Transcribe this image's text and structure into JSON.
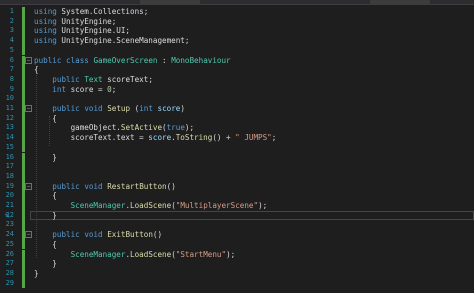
{
  "editor": {
    "lines": [
      {
        "n": "1",
        "tokens": [
          [
            "kw",
            "using"
          ],
          [
            "pl",
            " System.Collections;"
          ]
        ]
      },
      {
        "n": "2",
        "tokens": [
          [
            "kw",
            "using"
          ],
          [
            "pl",
            " UnityEngine;"
          ]
        ]
      },
      {
        "n": "3",
        "tokens": [
          [
            "kw",
            "using"
          ],
          [
            "pl",
            " UnityEngine.UI;"
          ]
        ]
      },
      {
        "n": "4",
        "tokens": [
          [
            "kw",
            "using"
          ],
          [
            "pl",
            " UnityEngine.SceneManagement;"
          ]
        ]
      },
      {
        "n": "5",
        "tokens": []
      },
      {
        "n": "6",
        "tokens": [
          [
            "kw",
            "public"
          ],
          [
            "pl",
            " "
          ],
          [
            "kw",
            "class"
          ],
          [
            "pl",
            " "
          ],
          [
            "ty",
            "GameOverScreen"
          ],
          [
            "pl",
            " : "
          ],
          [
            "ty",
            "MonoBehaviour"
          ]
        ]
      },
      {
        "n": "7",
        "tokens": [
          [
            "pl",
            "{"
          ]
        ]
      },
      {
        "n": "8",
        "tokens": [
          [
            "pl",
            "    "
          ],
          [
            "kw",
            "public"
          ],
          [
            "pl",
            " "
          ],
          [
            "ty",
            "Text"
          ],
          [
            "pl",
            " scoreText;"
          ]
        ]
      },
      {
        "n": "9",
        "tokens": [
          [
            "pl",
            "    "
          ],
          [
            "kw",
            "int"
          ],
          [
            "pl",
            " score = "
          ],
          [
            "nm",
            "0"
          ],
          [
            "pl",
            ";"
          ]
        ]
      },
      {
        "n": "10",
        "tokens": []
      },
      {
        "n": "11",
        "tokens": [
          [
            "pl",
            "    "
          ],
          [
            "kw",
            "public"
          ],
          [
            "pl",
            " "
          ],
          [
            "kw",
            "void"
          ],
          [
            "pl",
            " "
          ],
          [
            "mt",
            "Setup"
          ],
          [
            "pl",
            " ("
          ],
          [
            "kw",
            "int"
          ],
          [
            "pl",
            " "
          ],
          [
            "id",
            "score"
          ],
          [
            "pl",
            ")"
          ]
        ]
      },
      {
        "n": "12",
        "tokens": [
          [
            "pl",
            "    {"
          ]
        ]
      },
      {
        "n": "13",
        "tokens": [
          [
            "pl",
            "        gameObject."
          ],
          [
            "mt",
            "SetActive"
          ],
          [
            "pl",
            "("
          ],
          [
            "kw",
            "true"
          ],
          [
            "pl",
            ");"
          ]
        ]
      },
      {
        "n": "14",
        "tokens": [
          [
            "pl",
            "        scoreText.text = "
          ],
          [
            "id",
            "score"
          ],
          [
            "pl",
            "."
          ],
          [
            "mt",
            "ToString"
          ],
          [
            "pl",
            "() + "
          ],
          [
            "str",
            "\" JUMPS\""
          ],
          [
            "pl",
            ";"
          ]
        ]
      },
      {
        "n": "15",
        "tokens": []
      },
      {
        "n": "16",
        "tokens": [
          [
            "pl",
            "    }"
          ]
        ]
      },
      {
        "n": "17",
        "tokens": []
      },
      {
        "n": "18",
        "tokens": []
      },
      {
        "n": "19",
        "tokens": [
          [
            "pl",
            "    "
          ],
          [
            "kw",
            "public"
          ],
          [
            "pl",
            " "
          ],
          [
            "kw",
            "void"
          ],
          [
            "pl",
            " "
          ],
          [
            "mt",
            "RestartButton"
          ],
          [
            "pl",
            "()"
          ]
        ]
      },
      {
        "n": "20",
        "tokens": [
          [
            "pl",
            "    {"
          ]
        ]
      },
      {
        "n": "21",
        "tokens": [
          [
            "pl",
            "        "
          ],
          [
            "ty",
            "SceneManager"
          ],
          [
            "pl",
            "."
          ],
          [
            "mt",
            "LoadScene"
          ],
          [
            "pl",
            "("
          ],
          [
            "str",
            "\"MultiplayerScene\""
          ],
          [
            "pl",
            ");"
          ]
        ]
      },
      {
        "n": "22",
        "tokens": [
          [
            "pl",
            "    }"
          ]
        ]
      },
      {
        "n": "23",
        "tokens": []
      },
      {
        "n": "24",
        "tokens": [
          [
            "pl",
            "    "
          ],
          [
            "kw",
            "public"
          ],
          [
            "pl",
            " "
          ],
          [
            "kw",
            "void"
          ],
          [
            "pl",
            " "
          ],
          [
            "mt",
            "ExitButton"
          ],
          [
            "pl",
            "()"
          ]
        ]
      },
      {
        "n": "25",
        "tokens": [
          [
            "pl",
            "    {"
          ]
        ]
      },
      {
        "n": "26",
        "tokens": [
          [
            "pl",
            "        "
          ],
          [
            "ty",
            "SceneManager"
          ],
          [
            "pl",
            "."
          ],
          [
            "mt",
            "LoadScene"
          ],
          [
            "pl",
            "("
          ],
          [
            "str",
            "\"StartMenu\""
          ],
          [
            "pl",
            ");"
          ]
        ]
      },
      {
        "n": "27",
        "tokens": [
          [
            "pl",
            "    }"
          ]
        ]
      },
      {
        "n": "28",
        "tokens": [
          [
            "pl",
            "}"
          ]
        ]
      },
      {
        "n": "29",
        "tokens": []
      }
    ],
    "folds": {
      "6": "−",
      "11": "−",
      "19": "−",
      "24": "−"
    },
    "changed_lines": [
      "1",
      "2",
      "3",
      "4",
      "5",
      "6",
      "7",
      "8",
      "9",
      "10",
      "11",
      "12",
      "13",
      "14",
      "15",
      "16",
      "17",
      "18",
      "19",
      "20",
      "21",
      "22",
      "23",
      "24",
      "25",
      "26",
      "27",
      "28",
      "29"
    ],
    "current_line": "22",
    "pen_line": "22",
    "colors": {
      "background": "#1e1e1e",
      "keyword": "#569cd6",
      "type": "#4ec9b0",
      "string": "#d69d85",
      "method": "#dcdcaa",
      "line_number": "#2b91af",
      "change_bar": "#57a64a"
    }
  }
}
